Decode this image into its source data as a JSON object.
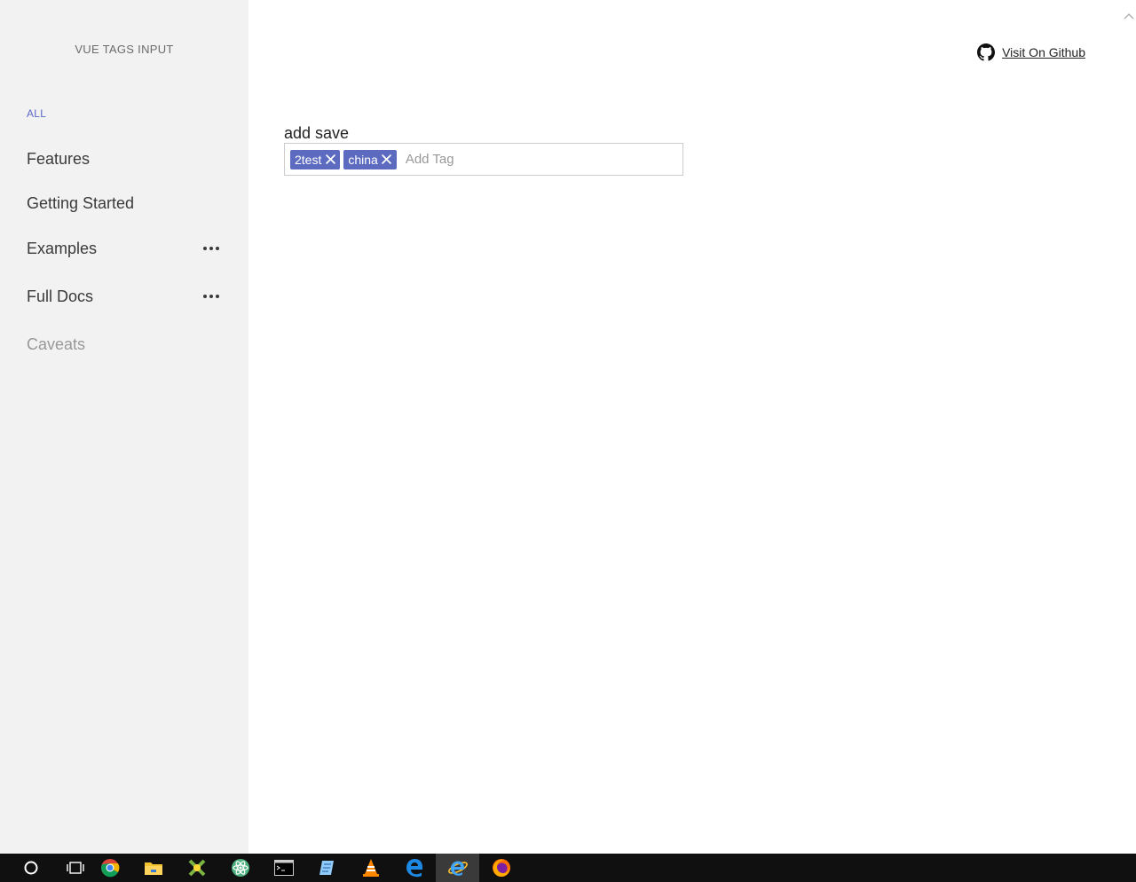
{
  "sidebar": {
    "brand": "VUE TAGS INPUT",
    "all_link": "ALL",
    "items": [
      {
        "label": "Features"
      },
      {
        "label": "Getting Started"
      },
      {
        "label": "Examples"
      },
      {
        "label": "Full Docs"
      },
      {
        "label": "Caveats"
      }
    ]
  },
  "header": {
    "github_link": "Visit On Github"
  },
  "form": {
    "label": "add save",
    "tags": [
      "2test",
      "china"
    ],
    "input_placeholder": "Add Tag",
    "input_value": ""
  },
  "colors": {
    "sidebar_bg": "#f2f2f2",
    "accent": "#5c6bc0",
    "taskbar_bg": "#101010"
  },
  "taskbar": {
    "icons": [
      "search-circle-icon",
      "task-view-icon",
      "chrome-icon",
      "file-explorer-icon",
      "app-icon",
      "atom-icon",
      "terminal-icon",
      "notepad-icon",
      "vlc-icon",
      "edge-icon",
      "internet-explorer-icon",
      "firefox-icon"
    ]
  }
}
